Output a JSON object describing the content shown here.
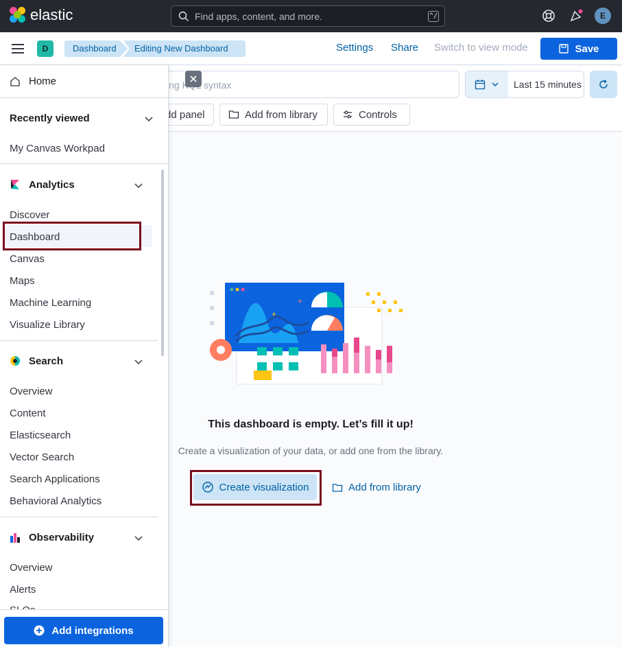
{
  "header": {
    "logo_text": "elastic",
    "search_placeholder": "Find apps, content, and more.",
    "search_shortcut": "^/",
    "avatar_initial": "E",
    "icons": [
      "help-icon",
      "news-icon"
    ]
  },
  "subheader": {
    "space_initial": "D",
    "breadcrumbs": [
      "Dashboard",
      "Editing New Dashboard"
    ],
    "links": {
      "settings": "Settings",
      "share": "Share",
      "switch_mode": "Switch to view mode",
      "save": "Save"
    }
  },
  "query": {
    "kql_placeholder": "ing KQL syntax",
    "date_range": "Last 15 minutes",
    "toolbar": {
      "add_panel": "dd panel",
      "add_from_library": "Add from library",
      "controls": "Controls"
    }
  },
  "sidenav": {
    "home": "Home",
    "recently_viewed": {
      "title": "Recently viewed",
      "items": [
        "My Canvas Workpad"
      ]
    },
    "analytics": {
      "title": "Analytics",
      "items": [
        "Discover",
        "Dashboard",
        "Canvas",
        "Maps",
        "Machine Learning",
        "Visualize Library"
      ]
    },
    "search": {
      "title": "Search",
      "items": [
        "Overview",
        "Content",
        "Elasticsearch",
        "Vector Search",
        "Search Applications",
        "Behavioral Analytics"
      ]
    },
    "observability": {
      "title": "Observability",
      "items": [
        "Overview",
        "Alerts",
        "SLOs"
      ]
    },
    "add_integrations": "Add integrations"
  },
  "empty_state": {
    "title": "This dashboard is empty. Let’s fill it up!",
    "description": "Create a visualization of your data, or add one from the library.",
    "create_button": "Create visualization",
    "add_from_library": "Add from library"
  },
  "colors": {
    "brand_blue": "#0b64dd",
    "highlight": "#7a0b1c",
    "header_bg": "#25282f"
  }
}
